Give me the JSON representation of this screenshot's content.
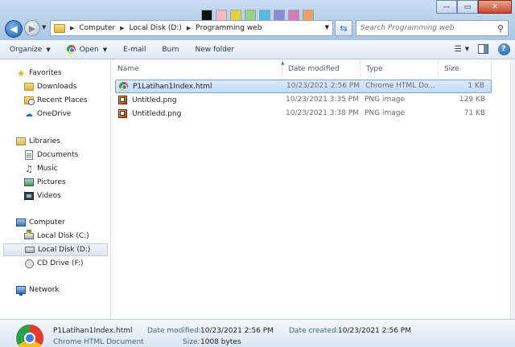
{
  "window": {
    "minimize_glyph": "—",
    "maximize_glyph": "▭",
    "close_glyph": "✕"
  },
  "address": {
    "crumbs": [
      "Computer",
      "Local Disk (D:)",
      "Programming web"
    ]
  },
  "search": {
    "placeholder": "Search Programming web"
  },
  "toolbar": {
    "organize": "Organize",
    "open": "Open",
    "email": "E-mail",
    "burn": "Burn",
    "new_folder": "New folder"
  },
  "navpane": {
    "favorites": "Favorites",
    "downloads": "Downloads",
    "recent_places": "Recent Places",
    "onedrive": "OneDrive",
    "libraries": "Libraries",
    "documents": "Documents",
    "music": "Music",
    "pictures": "Pictures",
    "videos": "Videos",
    "computer": "Computer",
    "local_c": "Local Disk (C:)",
    "local_d": "Local Disk (D:)",
    "cd_drive": "CD Drive (F:)",
    "network": "Network"
  },
  "columns": {
    "name": "Name",
    "date": "Date modified",
    "type": "Type",
    "size": "Size"
  },
  "files": [
    {
      "name": "P1Latihan1Index.html",
      "date": "10/23/2021 2:56 PM",
      "type": "Chrome HTML Do...",
      "size": "1 KB",
      "icon": "chrome-icon",
      "selected": true
    },
    {
      "name": "Untitled.png",
      "date": "10/23/2021 3:35 PM",
      "type": "PNG image",
      "size": "129 KB",
      "icon": "png-icon",
      "selected": false
    },
    {
      "name": "Untitledd.png",
      "date": "10/23/2021 3:38 PM",
      "type": "PNG image",
      "size": "71 KB",
      "icon": "png-icon",
      "selected": false
    }
  ],
  "details": {
    "filename": "P1Latihan1Index.html",
    "filetype": "Chrome HTML Document",
    "date_modified_label": "Date modified:",
    "date_modified": "10/23/2021 2:56 PM",
    "size_label": "Size:",
    "size": "1008 bytes",
    "date_created_label": "Date created:",
    "date_created": "10/23/2021 2:56 PM"
  }
}
